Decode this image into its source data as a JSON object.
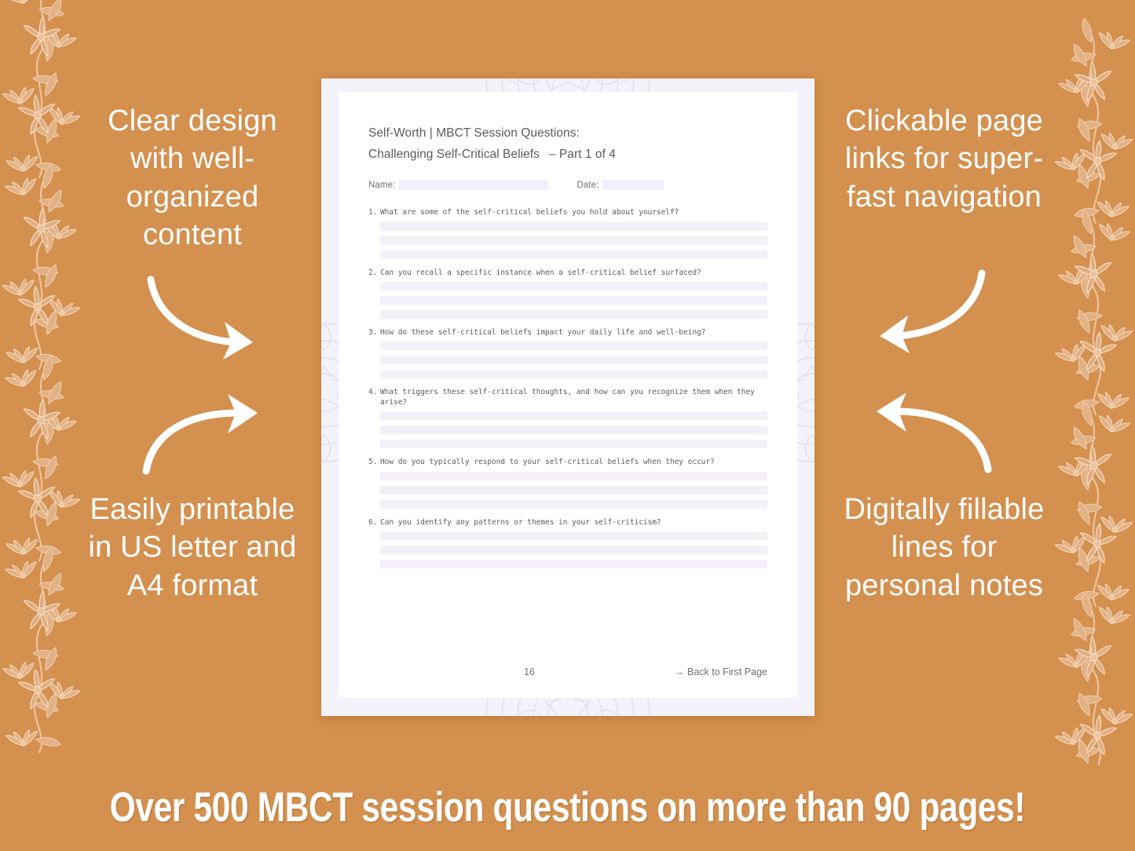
{
  "theme": {
    "background_color": "#d4904f",
    "page_outer_color": "#f4f2fa",
    "page_inner_color": "#ffffff",
    "fill_line_color": "#f3f0fa",
    "text_color": "#5d5d66",
    "callout_text_color": "#ffffff"
  },
  "callouts": {
    "top_left": "Clear design with well-organized content",
    "bottom_left": "Easily printable in US letter and A4 format",
    "top_right": "Clickable page links for super-fast navigation",
    "bottom_right": "Digitally fillable lines for personal notes"
  },
  "arrows": {
    "top_left": "curved-arrow-down-right-icon",
    "bottom_left": "curved-arrow-up-right-icon",
    "top_right": "curved-arrow-down-left-icon",
    "bottom_right": "curved-arrow-up-left-icon"
  },
  "worksheet": {
    "title_line1": "Self-Worth | MBCT Session Questions:",
    "title_line2": "Challenging Self-Critical Beliefs",
    "part_label": "– Part 1 of 4",
    "name_label": "Name:",
    "date_label": "Date:",
    "name_value": "",
    "date_value": "",
    "questions": [
      {
        "number": "1.",
        "text": "What are some of the self-critical beliefs you hold about yourself?",
        "answer_lines": 3
      },
      {
        "number": "2.",
        "text": "Can you recall a specific instance when a self-critical belief surfaced?",
        "answer_lines": 3
      },
      {
        "number": "3.",
        "text": "How do these self-critical beliefs impact your daily life and well-being?",
        "answer_lines": 3
      },
      {
        "number": "4.",
        "text": "What triggers these self-critical thoughts, and how can you recognize them when they arise?",
        "answer_lines": 3
      },
      {
        "number": "5.",
        "text": "How do you typically respond to your self-critical beliefs when they occur?",
        "answer_lines": 3
      },
      {
        "number": "6.",
        "text": "Can you identify any patterns or themes in your self-criticism?",
        "answer_lines": 3
      }
    ],
    "page_number": "16",
    "back_link": "→ Back to First Page"
  },
  "banner": {
    "text": "Over 500 MBCT session questions on more than 90 pages!"
  }
}
